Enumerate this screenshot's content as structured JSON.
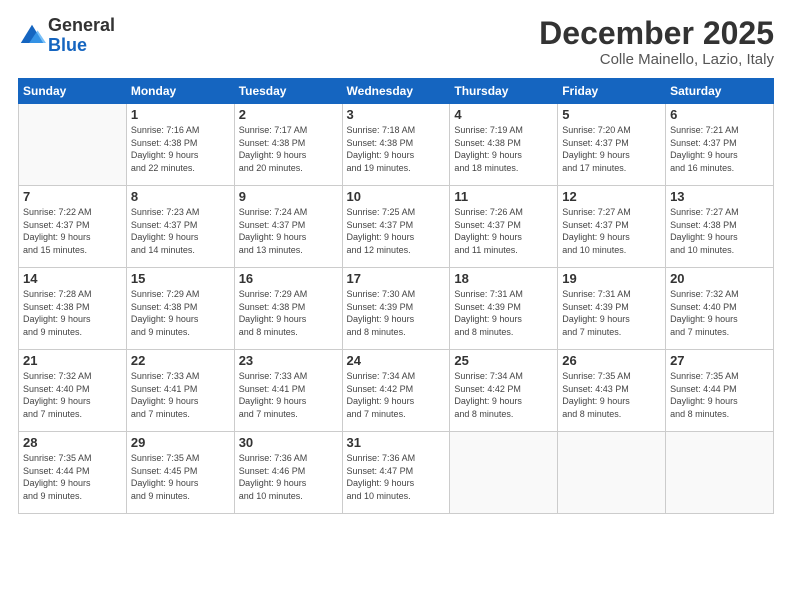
{
  "header": {
    "logo": {
      "general": "General",
      "blue": "Blue"
    },
    "title": "December 2025",
    "location": "Colle Mainello, Lazio, Italy"
  },
  "days_of_week": [
    "Sunday",
    "Monday",
    "Tuesday",
    "Wednesday",
    "Thursday",
    "Friday",
    "Saturday"
  ],
  "weeks": [
    [
      {
        "day": "",
        "info": ""
      },
      {
        "day": "1",
        "info": "Sunrise: 7:16 AM\nSunset: 4:38 PM\nDaylight: 9 hours\nand 22 minutes."
      },
      {
        "day": "2",
        "info": "Sunrise: 7:17 AM\nSunset: 4:38 PM\nDaylight: 9 hours\nand 20 minutes."
      },
      {
        "day": "3",
        "info": "Sunrise: 7:18 AM\nSunset: 4:38 PM\nDaylight: 9 hours\nand 19 minutes."
      },
      {
        "day": "4",
        "info": "Sunrise: 7:19 AM\nSunset: 4:38 PM\nDaylight: 9 hours\nand 18 minutes."
      },
      {
        "day": "5",
        "info": "Sunrise: 7:20 AM\nSunset: 4:37 PM\nDaylight: 9 hours\nand 17 minutes."
      },
      {
        "day": "6",
        "info": "Sunrise: 7:21 AM\nSunset: 4:37 PM\nDaylight: 9 hours\nand 16 minutes."
      }
    ],
    [
      {
        "day": "7",
        "info": "Sunrise: 7:22 AM\nSunset: 4:37 PM\nDaylight: 9 hours\nand 15 minutes."
      },
      {
        "day": "8",
        "info": "Sunrise: 7:23 AM\nSunset: 4:37 PM\nDaylight: 9 hours\nand 14 minutes."
      },
      {
        "day": "9",
        "info": "Sunrise: 7:24 AM\nSunset: 4:37 PM\nDaylight: 9 hours\nand 13 minutes."
      },
      {
        "day": "10",
        "info": "Sunrise: 7:25 AM\nSunset: 4:37 PM\nDaylight: 9 hours\nand 12 minutes."
      },
      {
        "day": "11",
        "info": "Sunrise: 7:26 AM\nSunset: 4:37 PM\nDaylight: 9 hours\nand 11 minutes."
      },
      {
        "day": "12",
        "info": "Sunrise: 7:27 AM\nSunset: 4:37 PM\nDaylight: 9 hours\nand 10 minutes."
      },
      {
        "day": "13",
        "info": "Sunrise: 7:27 AM\nSunset: 4:38 PM\nDaylight: 9 hours\nand 10 minutes."
      }
    ],
    [
      {
        "day": "14",
        "info": "Sunrise: 7:28 AM\nSunset: 4:38 PM\nDaylight: 9 hours\nand 9 minutes."
      },
      {
        "day": "15",
        "info": "Sunrise: 7:29 AM\nSunset: 4:38 PM\nDaylight: 9 hours\nand 9 minutes."
      },
      {
        "day": "16",
        "info": "Sunrise: 7:29 AM\nSunset: 4:38 PM\nDaylight: 9 hours\nand 8 minutes."
      },
      {
        "day": "17",
        "info": "Sunrise: 7:30 AM\nSunset: 4:39 PM\nDaylight: 9 hours\nand 8 minutes."
      },
      {
        "day": "18",
        "info": "Sunrise: 7:31 AM\nSunset: 4:39 PM\nDaylight: 9 hours\nand 8 minutes."
      },
      {
        "day": "19",
        "info": "Sunrise: 7:31 AM\nSunset: 4:39 PM\nDaylight: 9 hours\nand 7 minutes."
      },
      {
        "day": "20",
        "info": "Sunrise: 7:32 AM\nSunset: 4:40 PM\nDaylight: 9 hours\nand 7 minutes."
      }
    ],
    [
      {
        "day": "21",
        "info": "Sunrise: 7:32 AM\nSunset: 4:40 PM\nDaylight: 9 hours\nand 7 minutes."
      },
      {
        "day": "22",
        "info": "Sunrise: 7:33 AM\nSunset: 4:41 PM\nDaylight: 9 hours\nand 7 minutes."
      },
      {
        "day": "23",
        "info": "Sunrise: 7:33 AM\nSunset: 4:41 PM\nDaylight: 9 hours\nand 7 minutes."
      },
      {
        "day": "24",
        "info": "Sunrise: 7:34 AM\nSunset: 4:42 PM\nDaylight: 9 hours\nand 7 minutes."
      },
      {
        "day": "25",
        "info": "Sunrise: 7:34 AM\nSunset: 4:42 PM\nDaylight: 9 hours\nand 8 minutes."
      },
      {
        "day": "26",
        "info": "Sunrise: 7:35 AM\nSunset: 4:43 PM\nDaylight: 9 hours\nand 8 minutes."
      },
      {
        "day": "27",
        "info": "Sunrise: 7:35 AM\nSunset: 4:44 PM\nDaylight: 9 hours\nand 8 minutes."
      }
    ],
    [
      {
        "day": "28",
        "info": "Sunrise: 7:35 AM\nSunset: 4:44 PM\nDaylight: 9 hours\nand 9 minutes."
      },
      {
        "day": "29",
        "info": "Sunrise: 7:35 AM\nSunset: 4:45 PM\nDaylight: 9 hours\nand 9 minutes."
      },
      {
        "day": "30",
        "info": "Sunrise: 7:36 AM\nSunset: 4:46 PM\nDaylight: 9 hours\nand 10 minutes."
      },
      {
        "day": "31",
        "info": "Sunrise: 7:36 AM\nSunset: 4:47 PM\nDaylight: 9 hours\nand 10 minutes."
      },
      {
        "day": "",
        "info": ""
      },
      {
        "day": "",
        "info": ""
      },
      {
        "day": "",
        "info": ""
      }
    ]
  ]
}
